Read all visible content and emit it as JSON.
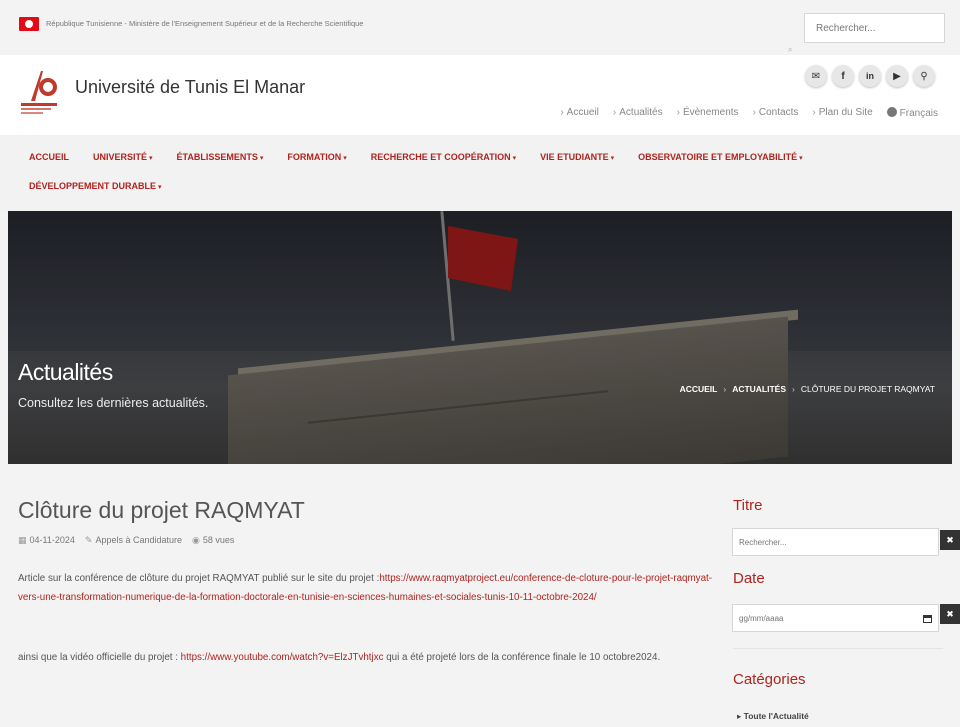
{
  "topbar": {
    "ministry_text": "République Tunisienne - Ministère de l'Enseignement Supérieur et de la Recherche Scientifique",
    "search_placeholder": "Rechercher..."
  },
  "header": {
    "site_title": "Université de Tunis El Manar",
    "social_icons": [
      "envelope-icon",
      "facebook-icon",
      "linkedin-icon",
      "youtube-icon",
      "map-pin-icon"
    ],
    "links": [
      "Accueil",
      "Actualités",
      "Évènements",
      "Contacts",
      "Plan du Site"
    ],
    "language": "Français"
  },
  "nav": {
    "row1": [
      "ACCUEIL",
      "UNIVERSITÉ",
      "ÉTABLISSEMENTS",
      "FORMATION",
      "RECHERCHE ET COOPÉRATION",
      "VIE ETUDIANTE",
      "OBSERVATOIRE ET EMPLOYABILITÉ"
    ],
    "row2": [
      "DÉVELOPPEMENT DURABLE"
    ]
  },
  "hero": {
    "title": "Actualités",
    "subtitle": "Consultez les dernières actualités.",
    "breadcrumb": [
      "ACCUEIL",
      "ACTUALITÉS",
      "CLÔTURE DU PROJET RAQMYAT"
    ]
  },
  "article": {
    "title": "Clôture du projet RAQMYAT",
    "date": "04-11-2024",
    "category": "Appels à Candidature",
    "views": "58 vues",
    "p1_text": "Article sur la conférence de clôture du projet RAQMYAT publié sur le site du projet :",
    "p1_link": "https://www.raqmyatproject.eu/conference-de-cloture-pour-le-projet-raqmyat-vers-une-transformation-numerique-de-la-formation-doctorale-en-tunisie-en-sciences-humaines-et-sociales-tunis-10-11-octobre-2024/",
    "p2_before": "ainsi que la vidéo officielle du projet : ",
    "p2_link": "https://www.youtube.com/watch?v=ElzJTvhtjxc",
    "p2_after": " qui a été projeté lors de la conférence finale le 10 octobre2024."
  },
  "sidebar": {
    "titre_heading": "Titre",
    "titre_placeholder": "Rechercher...",
    "date_heading": "Date",
    "date_placeholder": "gg/mm/aaaa",
    "categories_heading": "Catégories",
    "category_first": "Toute l'Actualité"
  },
  "colors": {
    "brand": "#b0231e"
  }
}
